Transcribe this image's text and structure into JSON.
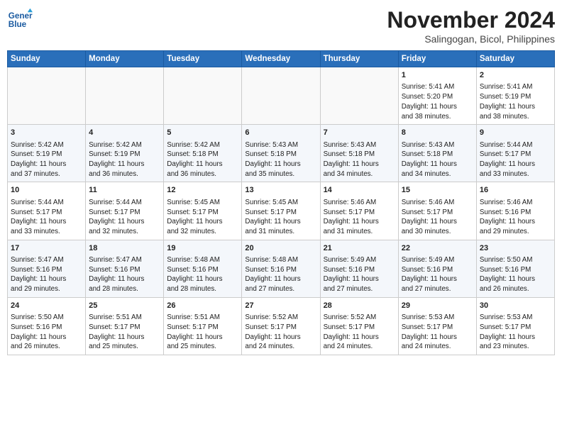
{
  "header": {
    "logo_line1": "General",
    "logo_line2": "Blue",
    "month": "November 2024",
    "location": "Salingogan, Bicol, Philippines"
  },
  "weekdays": [
    "Sunday",
    "Monday",
    "Tuesday",
    "Wednesday",
    "Thursday",
    "Friday",
    "Saturday"
  ],
  "weeks": [
    [
      {
        "day": "",
        "info": ""
      },
      {
        "day": "",
        "info": ""
      },
      {
        "day": "",
        "info": ""
      },
      {
        "day": "",
        "info": ""
      },
      {
        "day": "",
        "info": ""
      },
      {
        "day": "1",
        "info": "Sunrise: 5:41 AM\nSunset: 5:20 PM\nDaylight: 11 hours\nand 38 minutes."
      },
      {
        "day": "2",
        "info": "Sunrise: 5:41 AM\nSunset: 5:19 PM\nDaylight: 11 hours\nand 38 minutes."
      }
    ],
    [
      {
        "day": "3",
        "info": "Sunrise: 5:42 AM\nSunset: 5:19 PM\nDaylight: 11 hours\nand 37 minutes."
      },
      {
        "day": "4",
        "info": "Sunrise: 5:42 AM\nSunset: 5:19 PM\nDaylight: 11 hours\nand 36 minutes."
      },
      {
        "day": "5",
        "info": "Sunrise: 5:42 AM\nSunset: 5:18 PM\nDaylight: 11 hours\nand 36 minutes."
      },
      {
        "day": "6",
        "info": "Sunrise: 5:43 AM\nSunset: 5:18 PM\nDaylight: 11 hours\nand 35 minutes."
      },
      {
        "day": "7",
        "info": "Sunrise: 5:43 AM\nSunset: 5:18 PM\nDaylight: 11 hours\nand 34 minutes."
      },
      {
        "day": "8",
        "info": "Sunrise: 5:43 AM\nSunset: 5:18 PM\nDaylight: 11 hours\nand 34 minutes."
      },
      {
        "day": "9",
        "info": "Sunrise: 5:44 AM\nSunset: 5:17 PM\nDaylight: 11 hours\nand 33 minutes."
      }
    ],
    [
      {
        "day": "10",
        "info": "Sunrise: 5:44 AM\nSunset: 5:17 PM\nDaylight: 11 hours\nand 33 minutes."
      },
      {
        "day": "11",
        "info": "Sunrise: 5:44 AM\nSunset: 5:17 PM\nDaylight: 11 hours\nand 32 minutes."
      },
      {
        "day": "12",
        "info": "Sunrise: 5:45 AM\nSunset: 5:17 PM\nDaylight: 11 hours\nand 32 minutes."
      },
      {
        "day": "13",
        "info": "Sunrise: 5:45 AM\nSunset: 5:17 PM\nDaylight: 11 hours\nand 31 minutes."
      },
      {
        "day": "14",
        "info": "Sunrise: 5:46 AM\nSunset: 5:17 PM\nDaylight: 11 hours\nand 31 minutes."
      },
      {
        "day": "15",
        "info": "Sunrise: 5:46 AM\nSunset: 5:17 PM\nDaylight: 11 hours\nand 30 minutes."
      },
      {
        "day": "16",
        "info": "Sunrise: 5:46 AM\nSunset: 5:16 PM\nDaylight: 11 hours\nand 29 minutes."
      }
    ],
    [
      {
        "day": "17",
        "info": "Sunrise: 5:47 AM\nSunset: 5:16 PM\nDaylight: 11 hours\nand 29 minutes."
      },
      {
        "day": "18",
        "info": "Sunrise: 5:47 AM\nSunset: 5:16 PM\nDaylight: 11 hours\nand 28 minutes."
      },
      {
        "day": "19",
        "info": "Sunrise: 5:48 AM\nSunset: 5:16 PM\nDaylight: 11 hours\nand 28 minutes."
      },
      {
        "day": "20",
        "info": "Sunrise: 5:48 AM\nSunset: 5:16 PM\nDaylight: 11 hours\nand 27 minutes."
      },
      {
        "day": "21",
        "info": "Sunrise: 5:49 AM\nSunset: 5:16 PM\nDaylight: 11 hours\nand 27 minutes."
      },
      {
        "day": "22",
        "info": "Sunrise: 5:49 AM\nSunset: 5:16 PM\nDaylight: 11 hours\nand 27 minutes."
      },
      {
        "day": "23",
        "info": "Sunrise: 5:50 AM\nSunset: 5:16 PM\nDaylight: 11 hours\nand 26 minutes."
      }
    ],
    [
      {
        "day": "24",
        "info": "Sunrise: 5:50 AM\nSunset: 5:16 PM\nDaylight: 11 hours\nand 26 minutes."
      },
      {
        "day": "25",
        "info": "Sunrise: 5:51 AM\nSunset: 5:17 PM\nDaylight: 11 hours\nand 25 minutes."
      },
      {
        "day": "26",
        "info": "Sunrise: 5:51 AM\nSunset: 5:17 PM\nDaylight: 11 hours\nand 25 minutes."
      },
      {
        "day": "27",
        "info": "Sunrise: 5:52 AM\nSunset: 5:17 PM\nDaylight: 11 hours\nand 24 minutes."
      },
      {
        "day": "28",
        "info": "Sunrise: 5:52 AM\nSunset: 5:17 PM\nDaylight: 11 hours\nand 24 minutes."
      },
      {
        "day": "29",
        "info": "Sunrise: 5:53 AM\nSunset: 5:17 PM\nDaylight: 11 hours\nand 24 minutes."
      },
      {
        "day": "30",
        "info": "Sunrise: 5:53 AM\nSunset: 5:17 PM\nDaylight: 11 hours\nand 23 minutes."
      }
    ]
  ]
}
